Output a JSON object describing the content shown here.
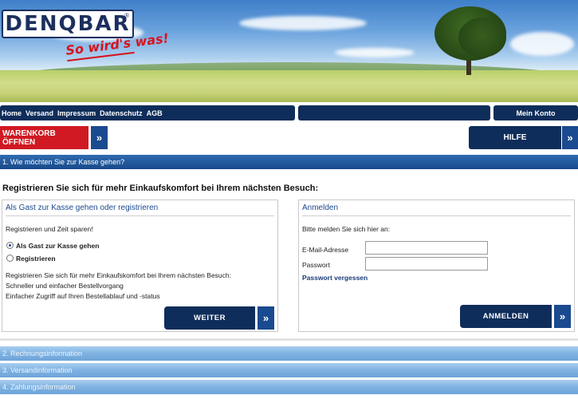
{
  "header": {
    "logo_text": "DENQBAR",
    "logo_mark": "®",
    "slogan": "So wird's was!"
  },
  "nav": {
    "links": [
      "Home",
      "Versand",
      "Impressum",
      "Datenschutz",
      "AGB"
    ],
    "account_label": "Mein Konto"
  },
  "toolbar": {
    "cart_label": "WARENKORB ÖFFNEN",
    "cart_arrow": "»",
    "help_label": "HILFE",
    "help_arrow": "»"
  },
  "checkout": {
    "active_step": "1. Wie möchten Sie zur Kasse gehen?",
    "section_title": "Registrieren Sie sich für mehr Einkaufskomfort bei Ihrem nächsten Besuch:",
    "guest_panel": {
      "heading": "Als Gast zur Kasse gehen oder registrieren",
      "intro": "Registrieren und Zeit sparen!",
      "options": [
        {
          "label": "Als Gast zur Kasse gehen",
          "checked": true
        },
        {
          "label": "Registrieren",
          "checked": false
        }
      ],
      "benefits": [
        "Registrieren Sie sich für mehr Einkaufskomfort bei Ihrem nächsten Besuch:",
        "Schneller und einfacher Bestellvorgang",
        "Einfacher Zugriff auf Ihren Bestellablauf und -status"
      ],
      "button_label": "WEITER",
      "button_arrow": "»"
    },
    "login_panel": {
      "heading": "Anmelden",
      "intro": "Bitte melden Sie sich hier an:",
      "email_label": "E-Mail-Adresse",
      "email_value": "",
      "password_label": "Passwort",
      "password_value": "",
      "forgot_link": "Passwort vergessen",
      "button_label": "ANMELDEN",
      "button_arrow": "»"
    },
    "closed_steps": [
      "2. Rechnungsinformation",
      "3. Versandinformation",
      "4. Zahlungsinformation"
    ]
  },
  "colors": {
    "brand_navy": "#0e2d5a",
    "cart_red": "#d01922",
    "link_blue": "#1a4a8f"
  }
}
